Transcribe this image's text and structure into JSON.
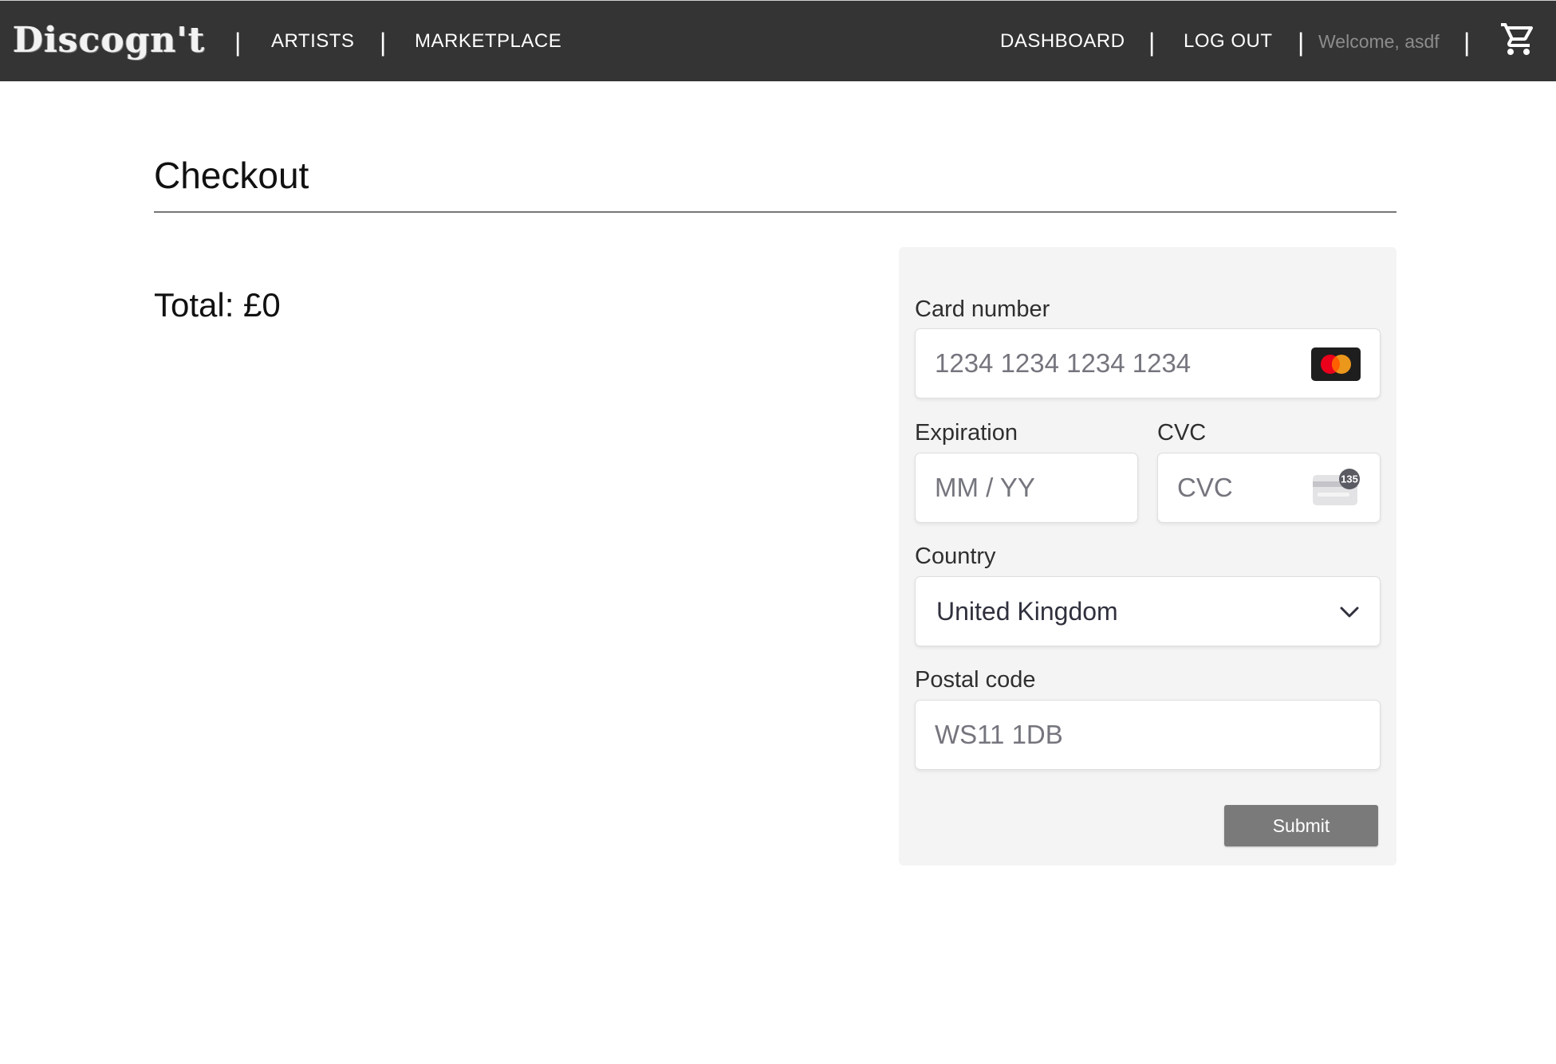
{
  "nav": {
    "logo": "Discogn't",
    "separator": "|",
    "links": [
      {
        "label": "ARTISTS"
      },
      {
        "label": "MARKETPLACE"
      }
    ],
    "right_links": [
      {
        "label": "DASHBOARD"
      },
      {
        "label": "LOG OUT"
      }
    ],
    "welcome": "Welcome, asdf",
    "cart_icon": "shopping-cart-icon"
  },
  "main": {
    "title": "Checkout",
    "total": "Total: £0"
  },
  "payment": {
    "card_number": {
      "label": "Card number",
      "placeholder": "1234 1234 1234 1234",
      "value": "",
      "brand_icon": "mastercard-icon"
    },
    "expiration": {
      "label": "Expiration",
      "placeholder": "MM / YY",
      "value": ""
    },
    "cvc": {
      "label": "CVC",
      "placeholder": "CVC",
      "value": "",
      "icon": "cvc-card-icon",
      "icon_text": "135"
    },
    "country": {
      "label": "Country",
      "selected": "United Kingdom"
    },
    "postal_code": {
      "label": "Postal code",
      "placeholder": "WS11 1DB",
      "value": ""
    },
    "submit_label": "Submit"
  },
  "colors": {
    "navbar_bg": "#343434",
    "panel_bg": "#f4f4f4",
    "submit_bg": "#7a7a7a",
    "mastercard_red": "#eb001b",
    "mastercard_orange": "#f79e1b"
  }
}
